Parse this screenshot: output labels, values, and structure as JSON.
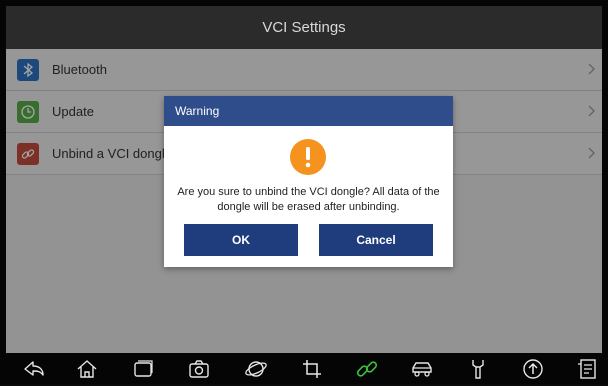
{
  "header": {
    "title": "VCI Settings"
  },
  "settings": {
    "items": [
      {
        "label": "Bluetooth",
        "icon": "bluetooth-icon",
        "color": "#2c6fbf"
      },
      {
        "label": "Update",
        "icon": "update-icon",
        "color": "#56a847"
      },
      {
        "label": "Unbind a VCI dongle",
        "icon": "link-icon",
        "color": "#c14a3e"
      }
    ]
  },
  "dialog": {
    "title": "Warning",
    "icon": "warning-icon",
    "message": "Are you sure to unbind the VCI dongle? All data of the dongle will be erased after unbinding.",
    "ok_label": "OK",
    "cancel_label": "Cancel",
    "accent": "#2f4d8a",
    "warning_color": "#f6921e"
  },
  "navbar": {
    "icons": [
      "back-icon",
      "home-icon",
      "recent-apps-icon",
      "camera-icon",
      "browser-icon",
      "crop-icon",
      "vci-link-icon",
      "car-icon",
      "wrench-icon",
      "upload-icon",
      "report-icon"
    ]
  }
}
